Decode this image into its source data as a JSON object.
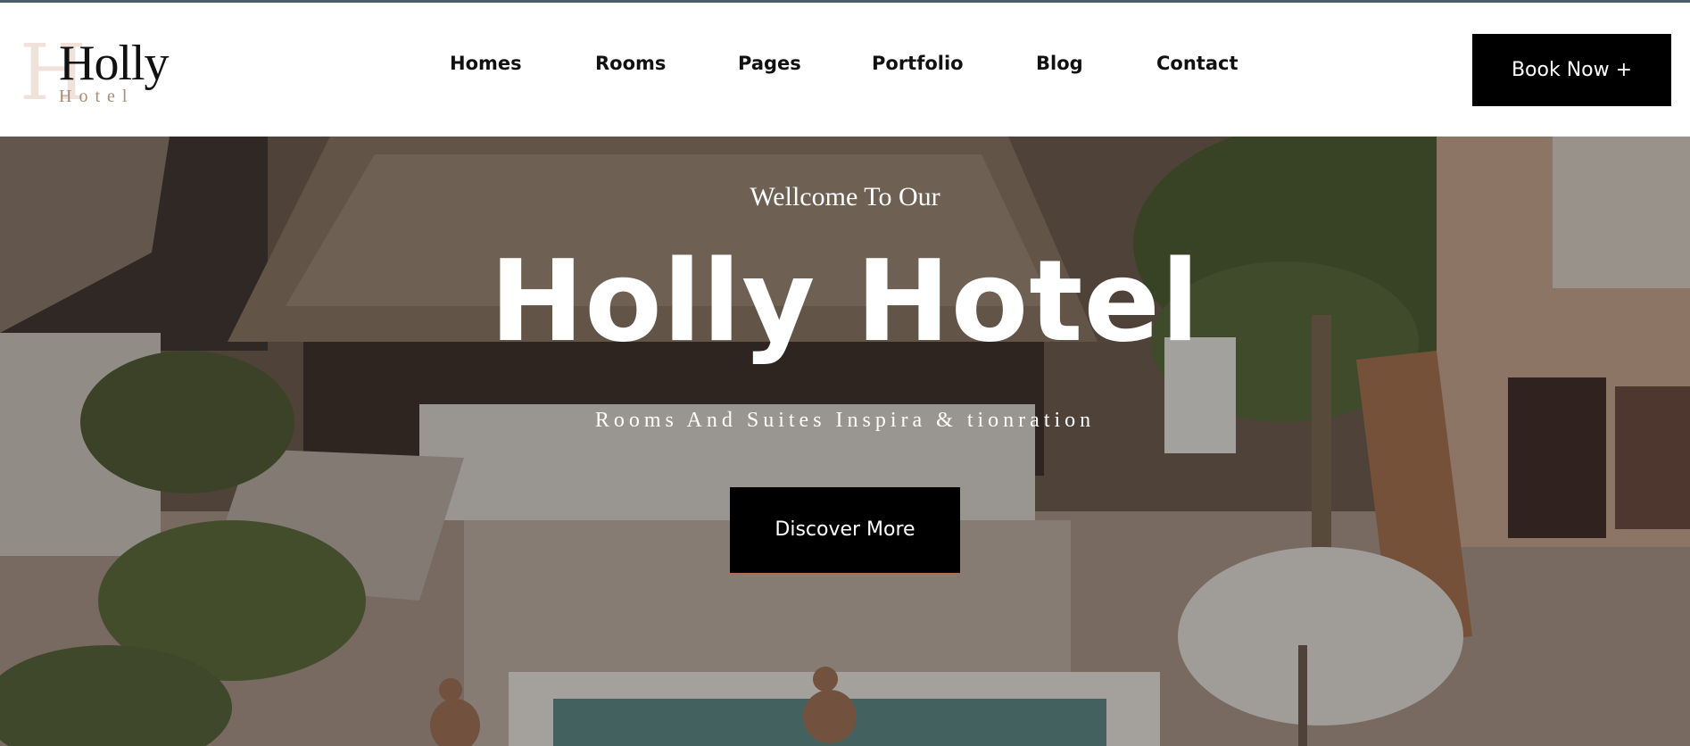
{
  "brand": {
    "logo_letter": "H",
    "logo_name": "Holly",
    "logo_sub": "Hotel"
  },
  "nav": {
    "items": [
      {
        "label": "Homes"
      },
      {
        "label": "Rooms"
      },
      {
        "label": "Pages"
      },
      {
        "label": "Portfolio"
      },
      {
        "label": "Blog"
      },
      {
        "label": "Contact"
      }
    ]
  },
  "header": {
    "book_label": "Book Now +"
  },
  "hero": {
    "welcome": "Wellcome To Our",
    "title": "Holly Hotel",
    "subtitle": "Rooms And Suites Inspira & tionration",
    "cta_label": "Discover More",
    "image_icon": "resort-pool-photo"
  },
  "colors": {
    "accent": "#000000",
    "top_line": "#4d5d68",
    "logo_sub": "#a98b7a",
    "button_underline": "#b36a4e"
  }
}
